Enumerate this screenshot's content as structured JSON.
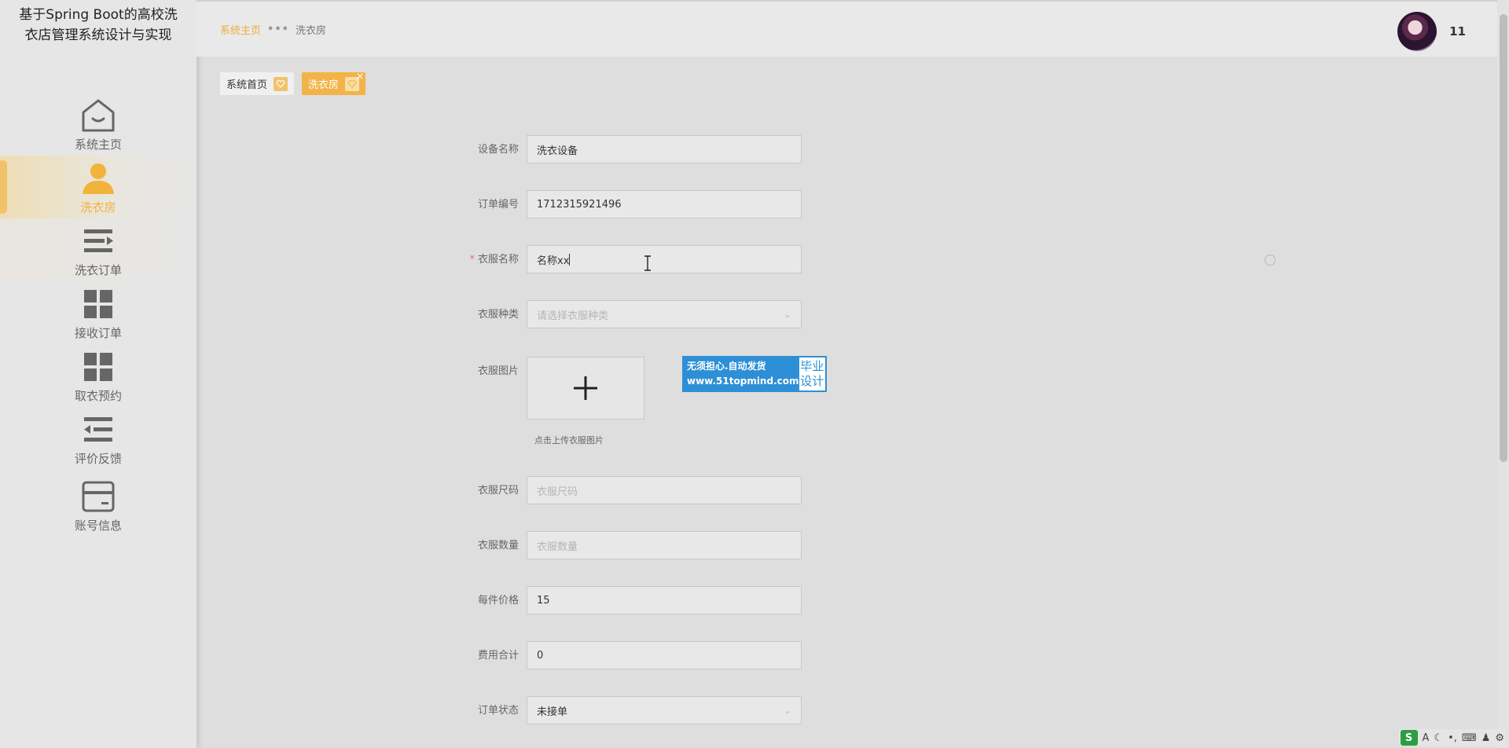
{
  "app_title": "基于Spring Boot的高校洗衣店管理系统设计与实现",
  "menu": [
    {
      "label": "系统主页",
      "icon": "home-icon"
    },
    {
      "label": "洗衣房",
      "icon": "user-icon"
    },
    {
      "label": "洗衣订单",
      "icon": "list-icon"
    },
    {
      "label": "接收订单",
      "icon": "grid-icon"
    },
    {
      "label": "取衣预约",
      "icon": "grid-icon"
    },
    {
      "label": "评价反馈",
      "icon": "indent-list-icon"
    },
    {
      "label": "账号信息",
      "icon": "card-icon"
    }
  ],
  "breadcrumb": {
    "home": "系统主页",
    "separator": "•••",
    "current": "洗衣房"
  },
  "user": {
    "name": "11"
  },
  "tags": [
    {
      "label": "系统首页"
    },
    {
      "label": "洗衣房",
      "close": "×"
    }
  ],
  "form": {
    "device_name": {
      "label": "设备名称",
      "value": "洗衣设备"
    },
    "order_no": {
      "label": "订单编号",
      "value": "1712315921496"
    },
    "cloth_name": {
      "label": "衣服名称",
      "required_mark": "*",
      "value": "名称xx"
    },
    "cloth_type": {
      "label": "衣服种类",
      "placeholder": "请选择衣服种类"
    },
    "cloth_image": {
      "label": "衣服图片",
      "tip": "点击上传衣服图片",
      "button": "+"
    },
    "cloth_size": {
      "label": "衣服尺码",
      "placeholder": "衣服尺码"
    },
    "cloth_qty": {
      "label": "衣服数量",
      "placeholder": "衣服数量"
    },
    "unit_price": {
      "label": "每件价格",
      "value": "15"
    },
    "total_fee": {
      "label": "费用合计",
      "value": "0"
    },
    "order_status": {
      "label": "订单状态",
      "value": "未接单"
    }
  },
  "ad": {
    "line1": "无须担心.自动发货",
    "line2": "www.51topmind.com",
    "right1": "毕业",
    "right2": "设计"
  },
  "ime": {
    "logo": "S",
    "items": [
      "A",
      "☾",
      "•,",
      "⌨",
      "♟",
      "⚙"
    ]
  },
  "colors": {
    "accent": "#f2b448",
    "sidebar_bg": "#e6e6e6",
    "ad_blue": "#2d8fd6"
  }
}
